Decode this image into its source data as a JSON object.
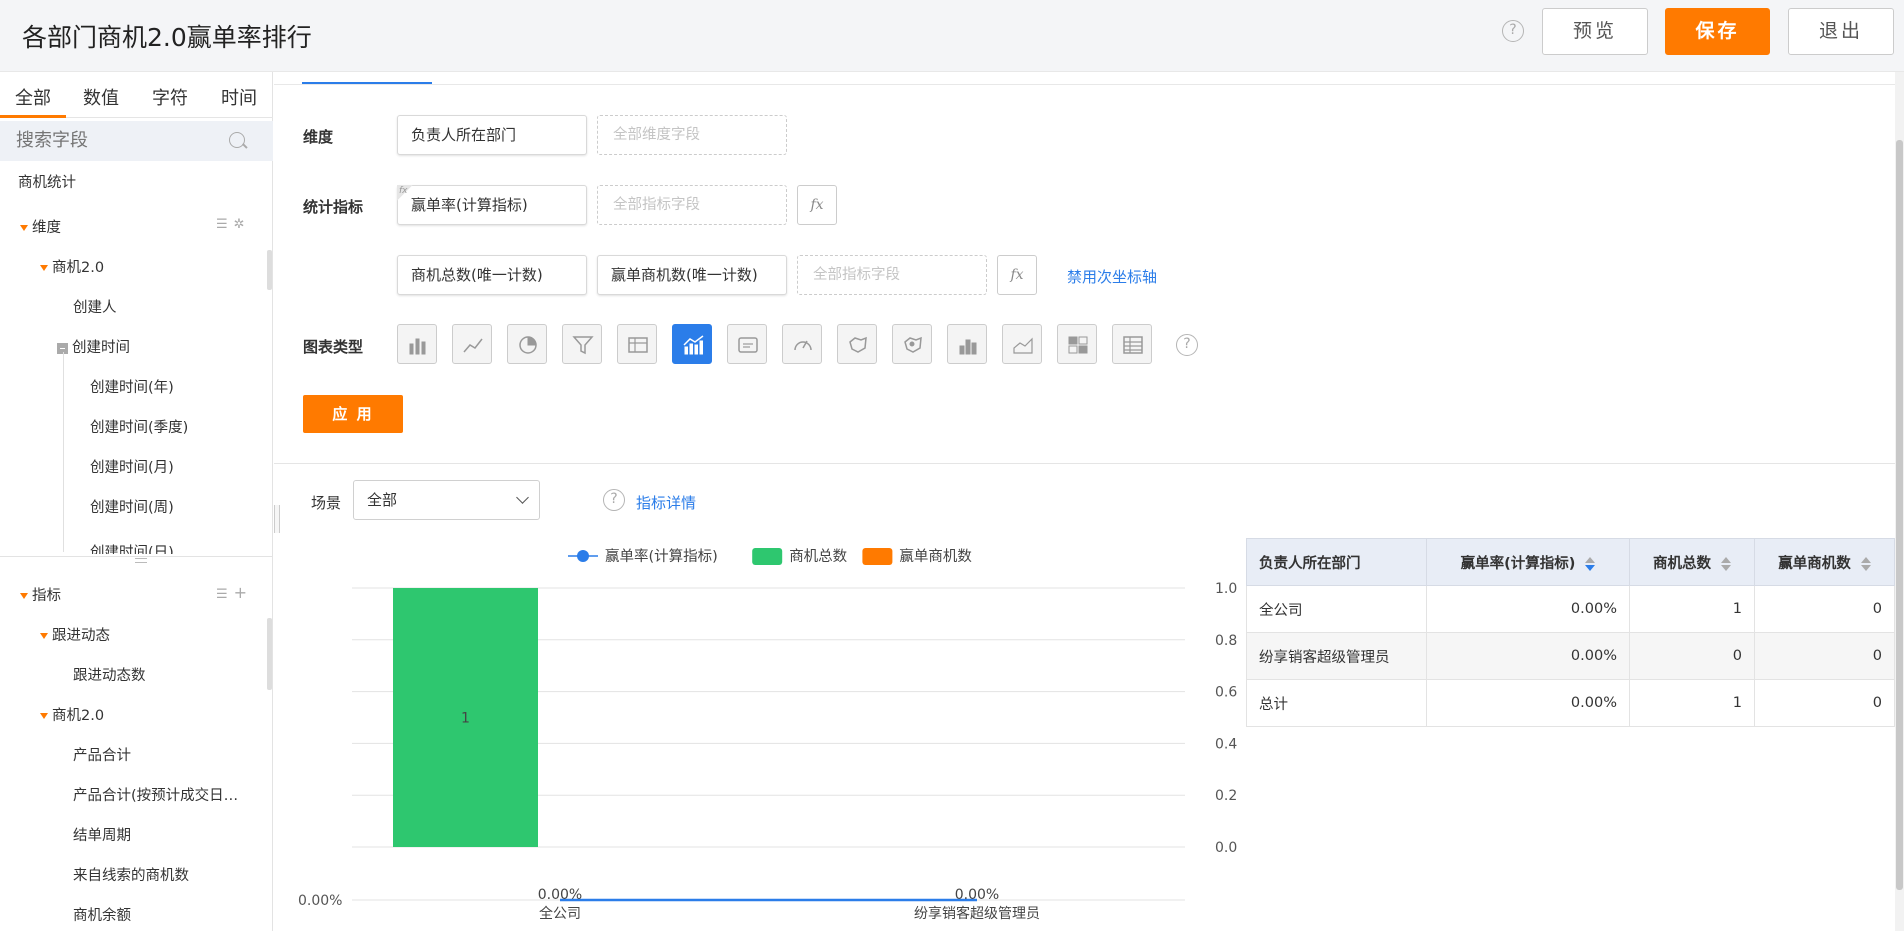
{
  "header": {
    "title": "各部门商机2.0赢单率排行",
    "preview_label": "预览",
    "save_label": "保存",
    "exit_label": "退出",
    "help_icon": "?"
  },
  "sidebar": {
    "tabs": [
      "全部",
      "数值",
      "字符",
      "时间"
    ],
    "search_placeholder": "搜索字段",
    "section_title": "商机统计",
    "dimension_label": "维度",
    "dimension_items": {
      "group": "商机2.0",
      "creator": "创建人",
      "created_time": "创建时间",
      "created_children": [
        "创建时间(年)",
        "创建时间(季度)",
        "创建时间(月)",
        "创建时间(周)",
        "创建时间(日)"
      ]
    },
    "metric_label": "指标",
    "metric_groups": [
      {
        "name": "跟进动态",
        "items": [
          "跟进动态数"
        ]
      },
      {
        "name": "商机2.0",
        "items": [
          "产品合计",
          "产品合计(按预计成交日…",
          "结单周期",
          "来自线索的商机数",
          "商机余额"
        ]
      }
    ]
  },
  "config": {
    "dimension_label": "维度",
    "dimension_value": "负责人所在部门",
    "dimension_placeholder": "全部维度字段",
    "metric_label": "统计指标",
    "metric_value": "赢单率(计算指标)",
    "metric_placeholder": "全部指标字段",
    "fx_label": "fx",
    "secondary_metrics": [
      "商机总数(唯一计数)",
      "赢单商机数(唯一计数)"
    ],
    "secondary_placeholder": "全部指标字段",
    "disable_axis_link": "禁用次坐标轴",
    "chart_type_label": "图表类型",
    "chart_type_icons": [
      "bar-chart-icon",
      "line-chart-icon",
      "pie-chart-icon",
      "funnel-chart-icon",
      "table-icon",
      "combo-chart-icon",
      "card-icon",
      "gauge-icon",
      "map-icon",
      "scatter-map-icon",
      "stacked-bar-icon",
      "area-chart-icon",
      "heatmap-icon",
      "pivot-table-icon"
    ],
    "apply_label": "应 用"
  },
  "scene": {
    "label": "场景",
    "value": "全部",
    "detail_link": "指标详情"
  },
  "chart_data": {
    "type": "bar",
    "categories": [
      "全公司",
      "纷享销客超级管理员"
    ],
    "series": [
      {
        "name": "赢单率(计算指标)",
        "type": "line",
        "values": [
          0.0,
          0.0
        ],
        "labels": [
          "0.00%",
          "0.00%"
        ],
        "color": "#2b7de9"
      },
      {
        "name": "商机总数",
        "type": "bar",
        "values": [
          1,
          0
        ],
        "labels": [
          "1",
          ""
        ],
        "color": "#2ec76f"
      },
      {
        "name": "赢单商机数",
        "type": "bar",
        "values": [
          0,
          0
        ],
        "color": "#ff7a00"
      }
    ],
    "right_axis_ticks": [
      "1.0",
      "0.8",
      "0.6",
      "0.4",
      "0.2",
      "0.0"
    ],
    "left_axis_tick": "0.00%",
    "ylim": [
      0,
      1.0
    ],
    "legend_position": "top-center"
  },
  "table": {
    "headers": [
      "负责人所在部门",
      "赢单率(计算指标)",
      "商机总数",
      "赢单商机数"
    ],
    "rows": [
      [
        "全公司",
        "0.00%",
        "1",
        "0"
      ],
      [
        "纷享销客超级管理员",
        "0.00%",
        "0",
        "0"
      ],
      [
        "总计",
        "0.00%",
        "1",
        "0"
      ]
    ]
  },
  "colors": {
    "accent": "#ff7a00",
    "link": "#2b7de9",
    "bar_green": "#2ec76f"
  }
}
